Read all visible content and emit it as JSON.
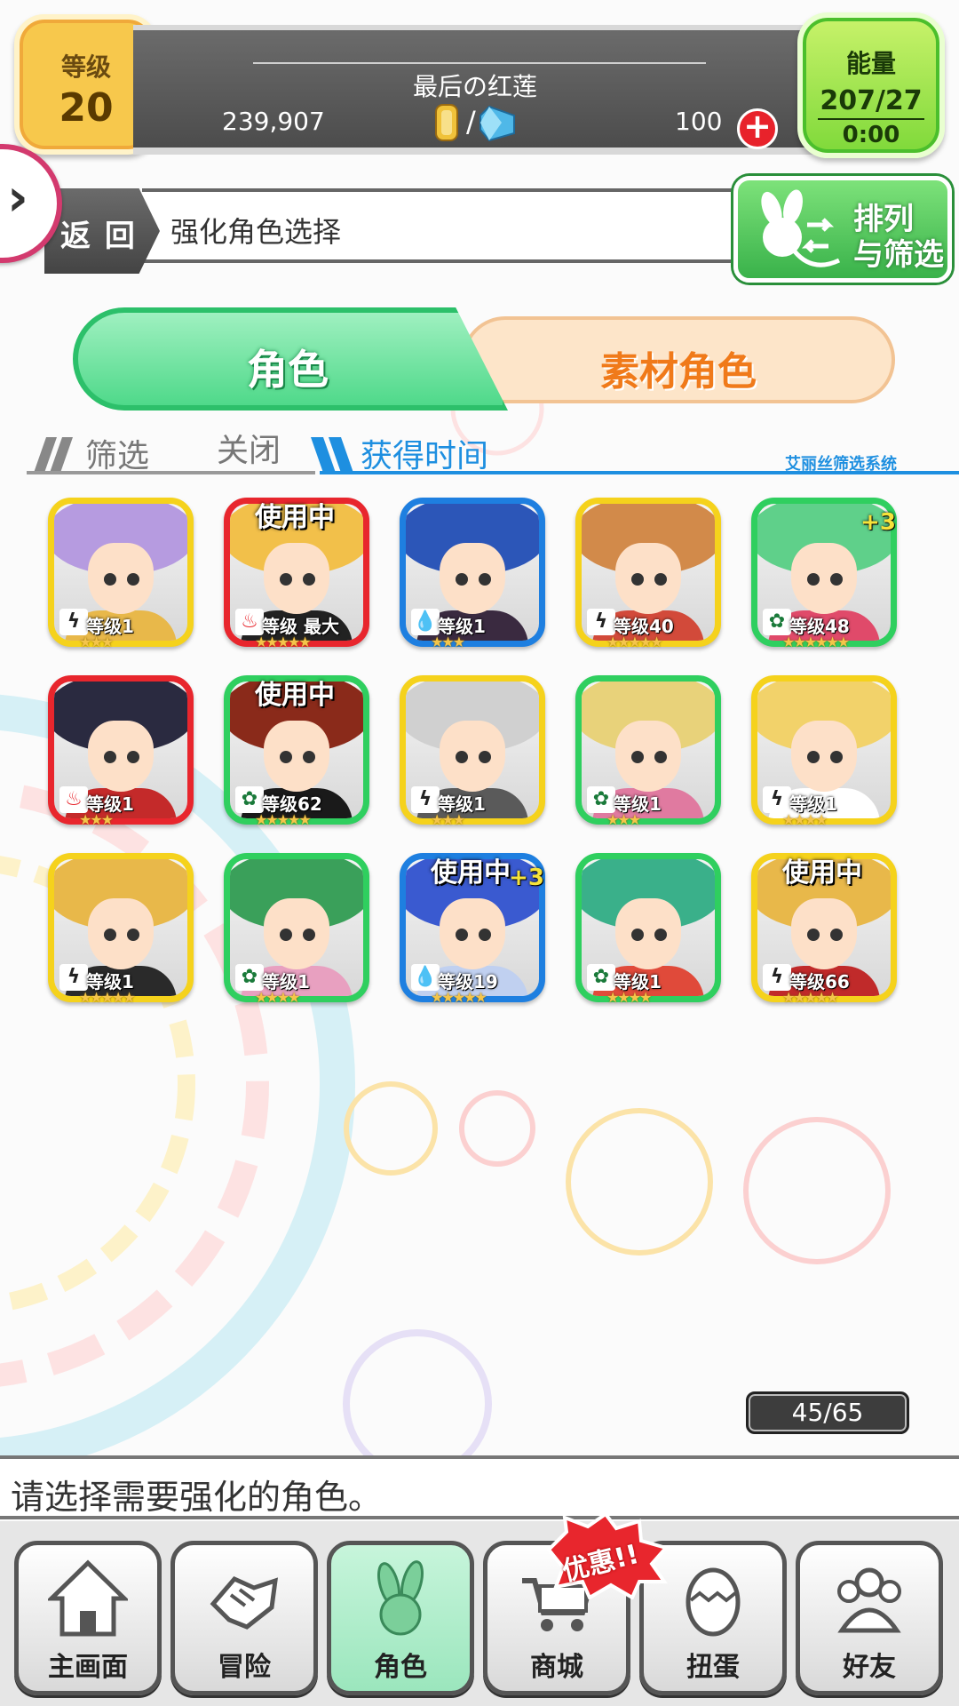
{
  "status": {
    "level_label": "等级",
    "level": "20",
    "player_name": "最后の红莲",
    "gold": "239,907",
    "currency_separator": "/",
    "gems": "100",
    "add_symbol": "+",
    "energy_label": "能量",
    "energy": "207/27",
    "energy_timer": "0:00"
  },
  "header": {
    "back_label": "返 回",
    "title": "强化角色选择",
    "sort_line1": "排列",
    "sort_line2": "与筛选"
  },
  "tabs": [
    {
      "label": "角色",
      "active": true
    },
    {
      "label": "素材角色",
      "active": false
    }
  ],
  "filter": {
    "label": "筛选",
    "state": "关闭",
    "sort": "获得时间",
    "system": "艾丽丝筛选系统"
  },
  "characters": [
    {
      "frame": "#f5d21c",
      "element": "lightning",
      "level": "等级1",
      "stars": "★★★",
      "in_use": "",
      "plus": "",
      "hair": "#b69be0",
      "outfit": "#e8b84a"
    },
    {
      "frame": "#e8262d",
      "element": "fire",
      "level": "等级 最大",
      "stars": "★★★★★",
      "in_use": "使用中",
      "plus": "",
      "hair": "#f2c04a",
      "outfit": "#222222"
    },
    {
      "frame": "#1e7fe0",
      "element": "water",
      "level": "等级1",
      "stars": "★★★",
      "in_use": "",
      "plus": "",
      "hair": "#2c56b8",
      "outfit": "#3a2a40"
    },
    {
      "frame": "#f5d21c",
      "element": "lightning",
      "level": "等级40",
      "stars": "★★★★★",
      "in_use": "",
      "plus": "",
      "hair": "#d28a4a",
      "outfit": "#d24a3a"
    },
    {
      "frame": "#2fcf5f",
      "element": "wind",
      "level": "等级48",
      "stars": "★★★★★★",
      "in_use": "",
      "plus": "+3",
      "hair": "#5fd08a",
      "outfit": "#e04a6a"
    },
    {
      "frame": "#e8262d",
      "element": "fire",
      "level": "等级1",
      "stars": "★★★",
      "in_use": "",
      "plus": "",
      "hair": "#2a2a40",
      "outfit": "#c42a2a"
    },
    {
      "frame": "#2fcf5f",
      "element": "wind",
      "level": "等级62",
      "stars": "★★★★★",
      "in_use": "使用中",
      "plus": "",
      "hair": "#8a2a1a",
      "outfit": "#1a1a1a"
    },
    {
      "frame": "#f5d21c",
      "element": "lightning",
      "level": "等级1",
      "stars": "★★★",
      "in_use": "",
      "plus": "",
      "hair": "#d0d0d0",
      "outfit": "#5a5a5a"
    },
    {
      "frame": "#2fcf5f",
      "element": "wind",
      "level": "等级1",
      "stars": "★★★",
      "in_use": "",
      "plus": "",
      "hair": "#e8d27a",
      "outfit": "#e07aa0"
    },
    {
      "frame": "#f5d21c",
      "element": "lightning",
      "level": "等级1",
      "stars": "★★★★",
      "in_use": "",
      "plus": "",
      "hair": "#f2d26a",
      "outfit": "#ffffff"
    },
    {
      "frame": "#f5d21c",
      "element": "lightning",
      "level": "等级1",
      "stars": "★★★★★",
      "in_use": "",
      "plus": "",
      "hair": "#e8b84a",
      "outfit": "#2a2a2a"
    },
    {
      "frame": "#2fcf5f",
      "element": "wind",
      "level": "等级1",
      "stars": "★★★★",
      "in_use": "",
      "plus": "",
      "hair": "#3aa05a",
      "outfit": "#e8a0c0"
    },
    {
      "frame": "#1e7fe0",
      "element": "water",
      "level": "等级19",
      "stars": "★★★★★",
      "in_use": "使用中",
      "plus": "+3",
      "hair": "#3a5ad0",
      "outfit": "#c0d0f0"
    },
    {
      "frame": "#2fcf5f",
      "element": "wind",
      "level": "等级1",
      "stars": "★★★★",
      "in_use": "",
      "plus": "",
      "hair": "#3ab08a",
      "outfit": "#e04a3a"
    },
    {
      "frame": "#f5d21c",
      "element": "lightning",
      "level": "等级66",
      "stars": "★★★★★",
      "in_use": "使用中",
      "plus": "",
      "hair": "#e8b84a",
      "outfit": "#c02a2a"
    }
  ],
  "element_glyphs": {
    "lightning": "ϟ",
    "fire": "♨",
    "water": "💧",
    "wind": "✿"
  },
  "element_colors": {
    "lightning": "#222222",
    "fire": "#e8262d",
    "water": "#1e7fe0",
    "wind": "#1a7a3a"
  },
  "counter": "45/65",
  "message": "请选择需要强化的角色。",
  "nav": [
    {
      "label": "主画面",
      "icon": "home-icon"
    },
    {
      "label": "冒险",
      "icon": "handshake-icon"
    },
    {
      "label": "角色",
      "icon": "rabbit-icon",
      "active": true
    },
    {
      "label": "商城",
      "icon": "cart-icon"
    },
    {
      "label": "扭蛋",
      "icon": "egg-icon"
    },
    {
      "label": "好友",
      "icon": "friends-icon"
    }
  ],
  "promo": "优惠!!"
}
